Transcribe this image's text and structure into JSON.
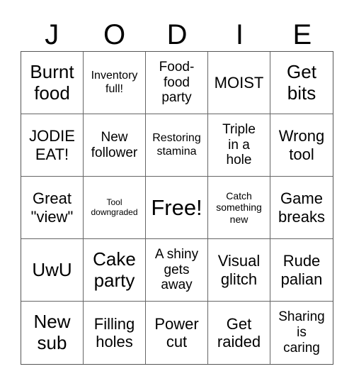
{
  "title_letters": [
    "J",
    "O",
    "D",
    "I",
    "E"
  ],
  "cells": [
    {
      "text": "Burnt\nfood",
      "size": "l"
    },
    {
      "text": "Inventory\nfull!",
      "size": "xs"
    },
    {
      "text": "Food-\nfood\nparty",
      "size": "s"
    },
    {
      "text": "MOIST",
      "size": "m"
    },
    {
      "text": "Get\nbits",
      "size": "l"
    },
    {
      "text": "JODIE\nEAT!",
      "size": "m"
    },
    {
      "text": "New\nfollower",
      "size": "s"
    },
    {
      "text": "Restoring\nstamina",
      "size": "xs"
    },
    {
      "text": "Triple\nin a\nhole",
      "size": "s"
    },
    {
      "text": "Wrong\ntool",
      "size": "m"
    },
    {
      "text": "Great\n\"view\"",
      "size": "m"
    },
    {
      "text": "Tool\ndowngraded",
      "size": "tiny"
    },
    {
      "text": "Free!",
      "size": "xl"
    },
    {
      "text": "Catch\nsomething\nnew",
      "size": "xxs"
    },
    {
      "text": "Game\nbreaks",
      "size": "m"
    },
    {
      "text": "UwU",
      "size": "l"
    },
    {
      "text": "Cake\nparty",
      "size": "l"
    },
    {
      "text": "A shiny\ngets\naway",
      "size": "s"
    },
    {
      "text": "Visual\nglitch",
      "size": "m"
    },
    {
      "text": "Rude\npalian",
      "size": "m"
    },
    {
      "text": "New\nsub",
      "size": "l"
    },
    {
      "text": "Filling\nholes",
      "size": "m"
    },
    {
      "text": "Power\ncut",
      "size": "m"
    },
    {
      "text": "Get\nraided",
      "size": "m"
    },
    {
      "text": "Sharing\nis\ncaring",
      "size": "s"
    }
  ]
}
